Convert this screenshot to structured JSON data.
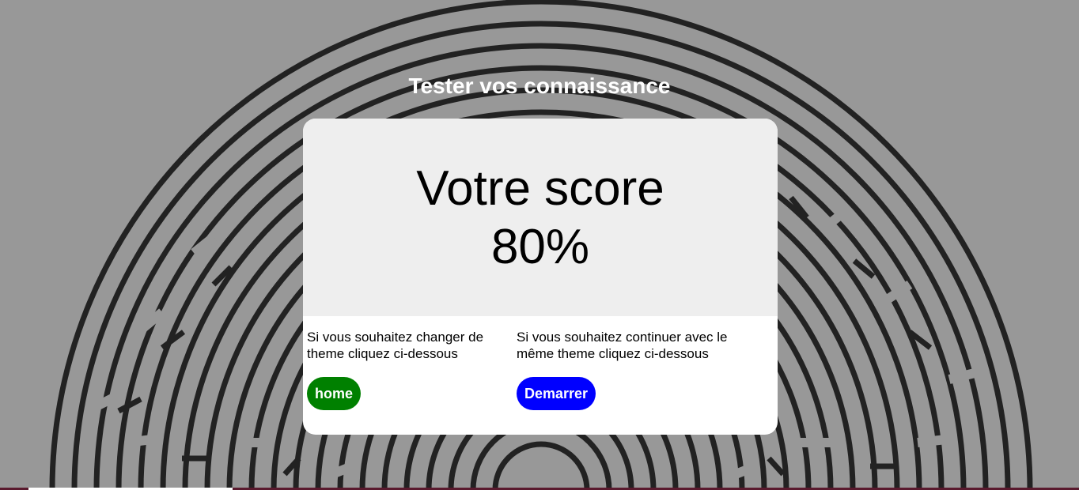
{
  "header": {
    "title": "Tester vos connaissance"
  },
  "result": {
    "label": "Votre score",
    "value": "80%"
  },
  "options": {
    "change_theme": {
      "text": "Si vous souhaitez changer de theme cliquez ci-dessous",
      "button_label": "home"
    },
    "same_theme": {
      "text": "Si vous souhaitez continuer avec le même theme cliquez ci-dessous",
      "button_label": "Demarrer"
    }
  },
  "colors": {
    "background": "#989898",
    "maze_stroke": "#222222",
    "home_button": "#008000",
    "start_button": "#0000ff"
  },
  "icons": {
    "background_image": "maze-pattern"
  }
}
